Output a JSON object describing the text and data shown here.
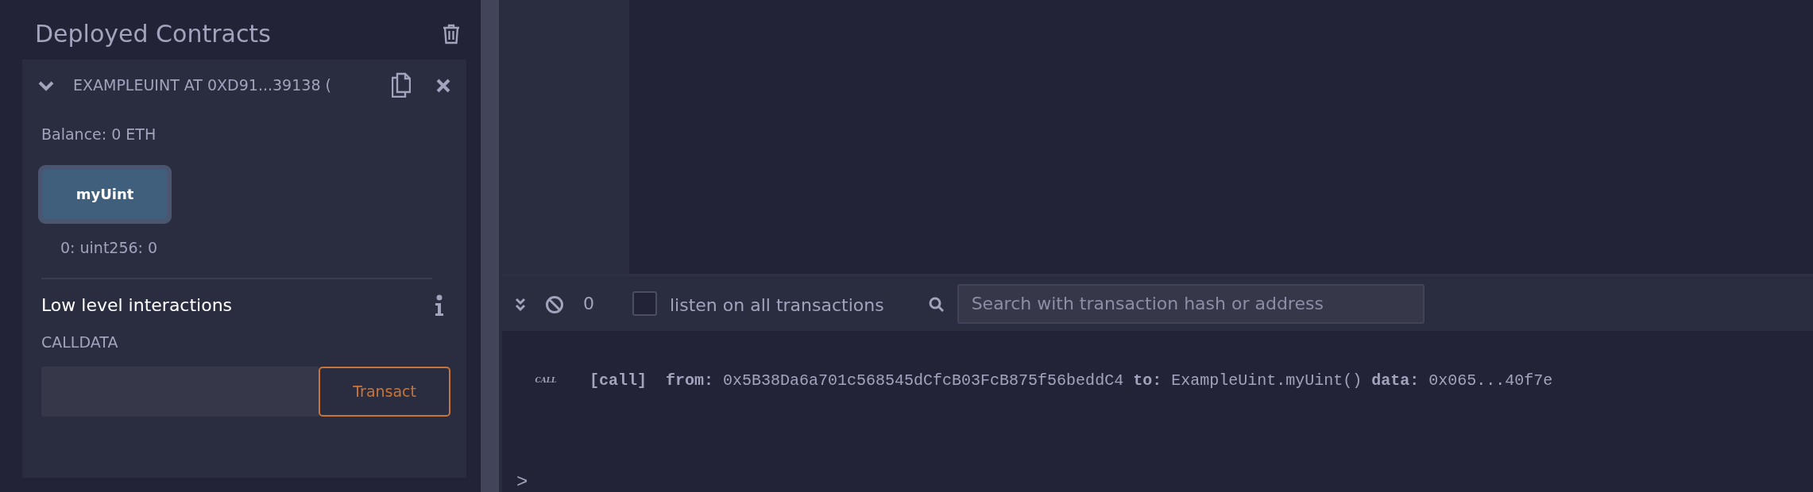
{
  "panel": {
    "title": "Deployed Contracts",
    "contract": {
      "name": "EXAMPLEUINT AT 0XD91...39138 (",
      "expanded": true,
      "balance": "Balance: 0 ETH",
      "functions": [
        {
          "label": "myUint",
          "output": "0: uint256: 0"
        }
      ],
      "low_level": {
        "title": "Low level interactions",
        "calldata_label": "CALLDATA",
        "transact": "Transact"
      }
    }
  },
  "terminal": {
    "pending_count": "0",
    "listen_label": "listen on all transactions",
    "listen_checked": false,
    "search": {
      "placeholder": "Search with transaction hash or address"
    },
    "logs": [
      {
        "badge": "CALL",
        "text": "**[call]**  **from:** 0x5B38Da6a701c568545dCfcB03FcB875f56beddC4 **to:** ExampleUint.myUint() **data:** 0x065...40f7e"
      }
    ],
    "prompt": ">"
  }
}
